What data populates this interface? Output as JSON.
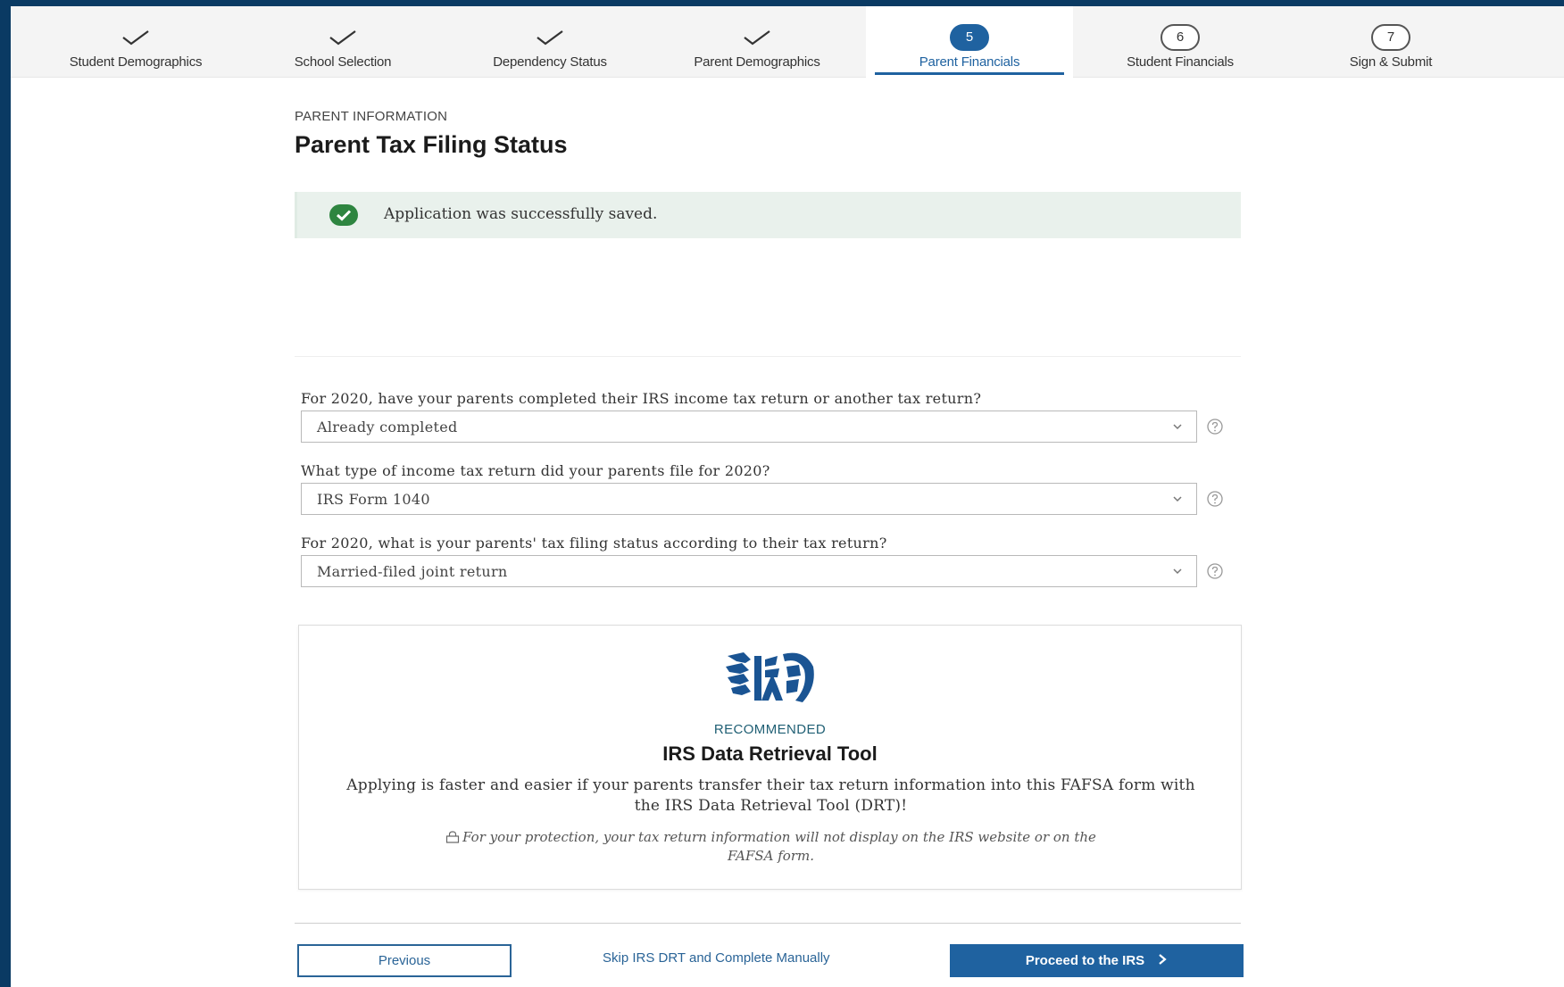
{
  "stepper": {
    "steps": [
      {
        "label": "Student Demographics",
        "status": "complete"
      },
      {
        "label": "School Selection",
        "status": "complete"
      },
      {
        "label": "Dependency Status",
        "status": "complete"
      },
      {
        "label": "Parent Demographics",
        "status": "complete"
      },
      {
        "label": "Parent Financials",
        "status": "current",
        "number": "5"
      },
      {
        "label": "Student Financials",
        "status": "upcoming",
        "number": "6"
      },
      {
        "label": "Sign & Submit",
        "status": "upcoming",
        "number": "7"
      }
    ]
  },
  "header": {
    "section": "PARENT INFORMATION",
    "title": "Parent Tax Filing Status"
  },
  "alert": {
    "message": "Application was successfully saved.",
    "color": "#2e8540"
  },
  "questions": [
    {
      "label": "For 2020, have your parents completed their IRS income tax return or another tax return?",
      "value": "Already completed"
    },
    {
      "label": "What type of income tax return did your parents file for 2020?",
      "value": "IRS Form 1040"
    },
    {
      "label": "For 2020, what is your parents' tax filing status according to their tax return?",
      "value": "Married-filed joint return"
    }
  ],
  "drt": {
    "logo": "irs-eagle-logo",
    "recommended": "RECOMMENDED",
    "title": "IRS Data Retrieval Tool",
    "description": "Applying is faster and easier if your parents transfer their tax return information into this FAFSA form with the IRS Data Retrieval Tool (DRT)!",
    "note": "For your protection, your tax return information will not display on the IRS website or on the FAFSA form."
  },
  "footer": {
    "previous": "Previous",
    "skip": "Skip IRS DRT and Complete Manually",
    "proceed": "Proceed to the IRS"
  },
  "colors": {
    "primary": "#1f62a0",
    "success": "#2e8540",
    "border": "#0a3a63"
  }
}
